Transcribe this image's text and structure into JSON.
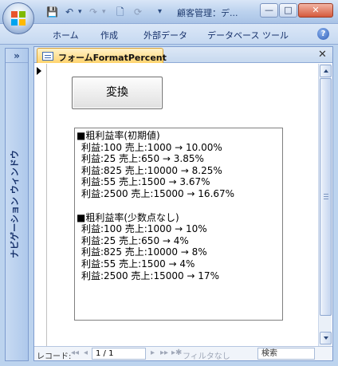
{
  "window": {
    "title": "顧客管理：デ..."
  },
  "quick_access": {
    "save": "💾",
    "undo": "↶",
    "undo_drop": "▾",
    "redo": "↷",
    "redo_drop": "▾",
    "new": "🗋",
    "refresh": "⟳",
    "customize": "▾"
  },
  "window_buttons": {
    "minimize": "—",
    "maximize": "□",
    "close": "✕"
  },
  "ribbon": {
    "tabs": [
      "ホーム",
      "作成",
      "外部データ",
      "データベース ツール"
    ],
    "help": "?"
  },
  "nav_pane": {
    "toggle": "»",
    "label": "ナビゲーション ウィンドウ"
  },
  "document": {
    "tab_label": "フォームFormatPercent",
    "close": "✕",
    "convert_button": "変換",
    "output": {
      "section1_title": "■粗利益率(初期値)",
      "section1_lines": [
        "利益:100 売上:1000 → 10.00%",
        "利益:25 売上:650 → 3.85%",
        "利益:825 売上:10000 → 8.25%",
        "利益:55 売上:1500 → 3.67%",
        "利益:2500 売上:15000 → 16.67%"
      ],
      "section2_title": "■粗利益率(少数点なし)",
      "section2_lines": [
        "利益:100 売上:1000 → 10%",
        "利益:25 売上:650 → 4%",
        "利益:825 売上:10000 → 8%",
        "利益:55 売上:1500 → 4%",
        "利益:2500 売上:15000 → 17%"
      ]
    }
  },
  "record_nav": {
    "label": "レコード:",
    "first": "◂◂",
    "prev": "◂",
    "position": "1 / 1",
    "next": "▸",
    "last": "▸▸",
    "new": "▸✱",
    "filter": "フィルタなし",
    "search_placeholder": "検索"
  }
}
